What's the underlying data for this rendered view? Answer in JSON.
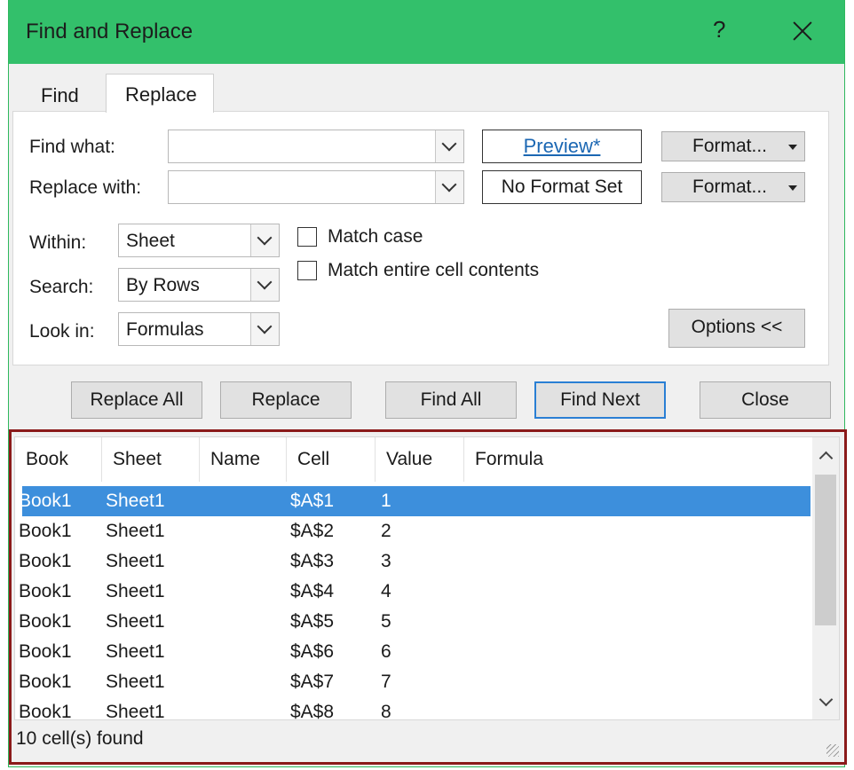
{
  "dialog": {
    "title": "Find and Replace",
    "help": "?"
  },
  "tabs": {
    "find": "Find",
    "replace": "Replace"
  },
  "fields": {
    "find_what_label": "Find what:",
    "replace_with_label": "Replace with:",
    "find_what_value": "",
    "replace_with_value": ""
  },
  "format": {
    "preview": "Preview*",
    "no_format": "No Format Set",
    "format_btn": "Format..."
  },
  "options": {
    "within_label": "Within:",
    "within_value": "Sheet",
    "search_label": "Search:",
    "search_value": "By Rows",
    "lookin_label": "Look in:",
    "lookin_value": "Formulas",
    "match_case": "Match case",
    "match_entire": "Match entire cell contents",
    "match_case_checked": false,
    "match_entire_checked": false,
    "options_btn": "Options <<"
  },
  "buttons": {
    "replace_all": "Replace All",
    "replace": "Replace",
    "find_all": "Find All",
    "find_next": "Find Next",
    "close": "Close"
  },
  "results": {
    "columns": [
      "Book",
      "Sheet",
      "Name",
      "Cell",
      "Value",
      "Formula"
    ],
    "rows": [
      [
        "Book1",
        "Sheet1",
        "",
        "$A$1",
        "1",
        ""
      ],
      [
        "Book1",
        "Sheet1",
        "",
        "$A$2",
        "2",
        ""
      ],
      [
        "Book1",
        "Sheet1",
        "",
        "$A$3",
        "3",
        ""
      ],
      [
        "Book1",
        "Sheet1",
        "",
        "$A$4",
        "4",
        ""
      ],
      [
        "Book1",
        "Sheet1",
        "",
        "$A$5",
        "5",
        ""
      ],
      [
        "Book1",
        "Sheet1",
        "",
        "$A$6",
        "6",
        ""
      ],
      [
        "Book1",
        "Sheet1",
        "",
        "$A$7",
        "7",
        ""
      ],
      [
        "Book1",
        "Sheet1",
        "",
        "$A$8",
        "8",
        ""
      ]
    ],
    "selected_row": 0,
    "status": "10 cell(s) found"
  },
  "colors": {
    "titlebar": "#33c06b",
    "selection": "#3d8fdc",
    "results_border": "#8b1a1a"
  }
}
